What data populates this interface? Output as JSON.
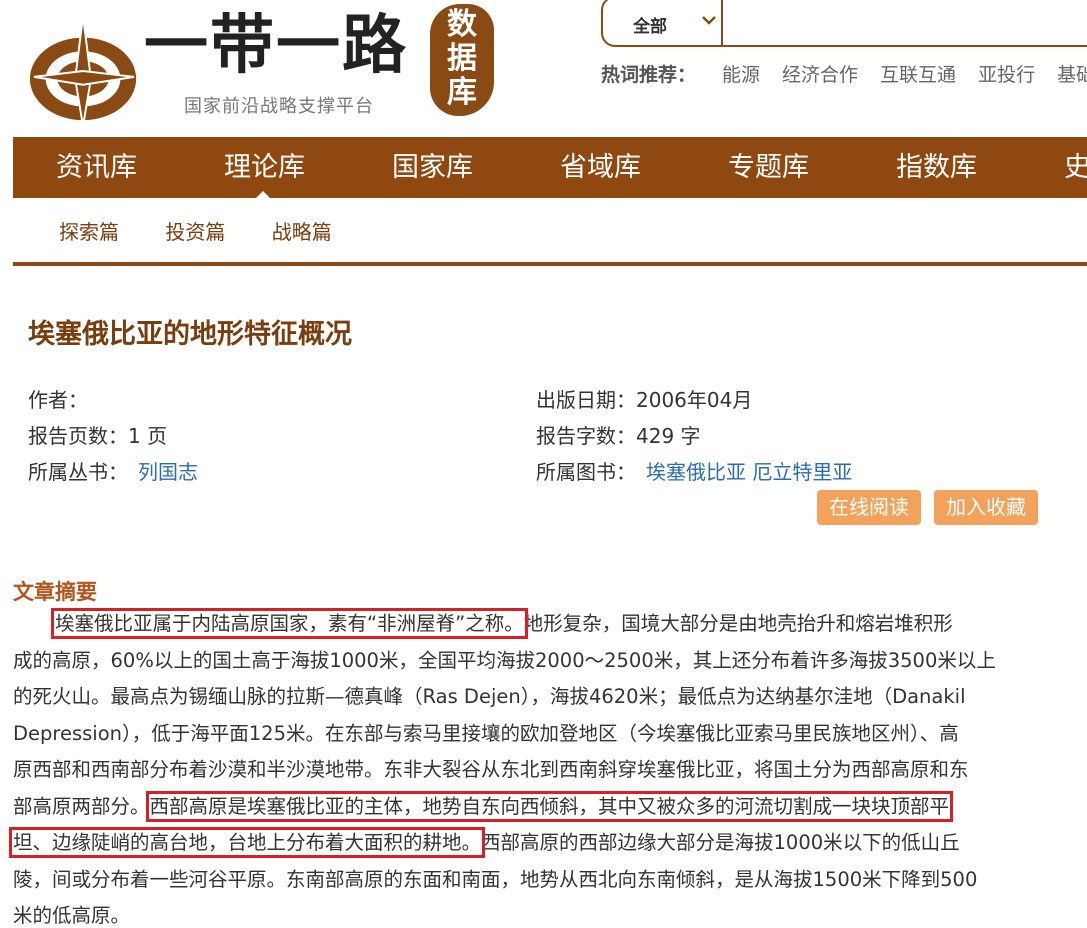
{
  "site": {
    "logo_title": "一带一路",
    "logo_seal": [
      "数",
      "据",
      "库"
    ],
    "logo_subtitle": "国家前沿战略支撑平台"
  },
  "search": {
    "scope_label": "全部"
  },
  "hotwords": {
    "label": "热词推荐：",
    "items": [
      "能源",
      "经济合作",
      "互联互通",
      "亚投行",
      "基础"
    ]
  },
  "nav": {
    "items": [
      "资讯库",
      "理论库",
      "国家库",
      "省域库",
      "专题库",
      "指数库",
      "史"
    ]
  },
  "subnav": {
    "items": [
      "探索篇",
      "投资篇",
      "战略篇"
    ]
  },
  "article": {
    "title": "埃塞俄比亚的地形特征概况",
    "author_label": "作者：",
    "pages": "报告页数：1 页",
    "series_label": "所属丛书：",
    "series_link": "列国志",
    "publish_date": "出版日期：2006年04月",
    "word_count": "报告字数：429 字",
    "book_label": "所属图书：",
    "book_link": "埃塞俄比亚 厄立特里亚"
  },
  "actions": {
    "read_online": "在线阅读",
    "add_favorite": "加入收藏"
  },
  "abstract": {
    "heading": "文章摘要",
    "lines": [
      {
        "h": "埃塞俄比亚属于内陆高原国家，素有“非洲屋脊”之称。",
        "t": "地形复杂，国境大部分是由地壳抬升和熔岩堆积形"
      },
      {
        "t": "成的高原，60%以上的国土高于海拔1000米，全国平均海拔2000～2500米，其上还分布着许多海拔3500米以上"
      },
      {
        "t": "的死火山。最高点为锡缅山脉的拉斯—德真峰（Ras Dejen），海拔4620米；最低点为达纳基尔洼地（Danakil"
      },
      {
        "t": "Depression），低于海平面125米。在东部与索马里接壤的欧加登地区（今埃塞俄比亚索马里民族地区州）、高"
      },
      {
        "t": "原西部和西南部分布着沙漠和半沙漠地带。东非大裂谷从东北到西南斜穿埃塞俄比亚，将国土分为西部高原和东"
      },
      {
        "t": "部高原两部分。",
        "h": "西部高原是埃塞俄比亚的主体，地势自东向西倾斜，其中又被众多的河流切割成一块块顶部平"
      },
      {
        "h": "坦、边缘陡峭的高台地，台地上分布着大面积的耕地。",
        "t": "西部高原的西部边缘大部分是海拔1000米以下的低山丘"
      },
      {
        "t": "陵，间或分布着一些河谷平原。东南部高原的东面和南面，地势从西北向东南倾斜，是从海拔1500米下降到500"
      },
      {
        "t": "米的低高原。"
      }
    ]
  }
}
